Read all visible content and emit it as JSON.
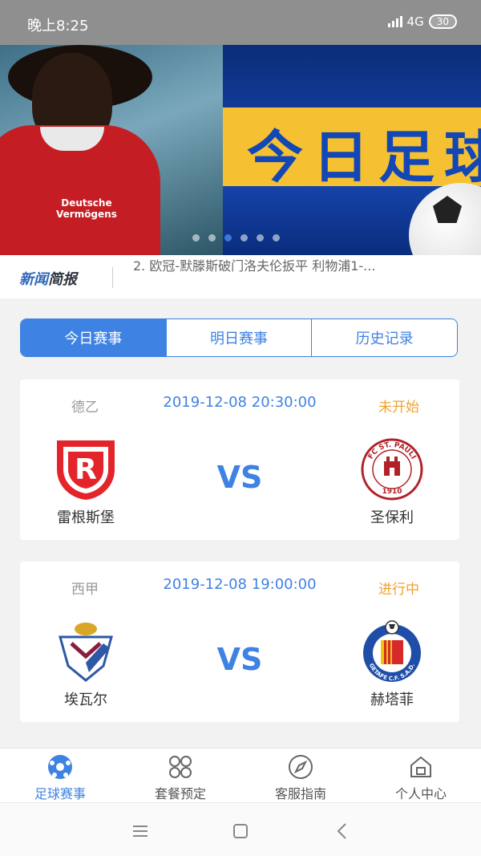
{
  "status_bar": {
    "time": "晚上8:25",
    "network": "4G",
    "battery": "30"
  },
  "banner": {
    "title": "今日足球",
    "sponsor": [
      "Deutsche",
      "Vermögens"
    ],
    "dot_count": 6,
    "active_dot": 2
  },
  "news": {
    "logo_part1": "新闻",
    "logo_part2": "简报",
    "headline": "2. 欧冠-默滕斯破门洛夫伦扳平 利物浦1-..."
  },
  "tabs": [
    {
      "label": "今日赛事",
      "active": true
    },
    {
      "label": "明日赛事",
      "active": false
    },
    {
      "label": "历史记录",
      "active": false
    }
  ],
  "matches": [
    {
      "league": "德乙",
      "time": "2019-12-08 20:30:00",
      "status": "未开始",
      "home": {
        "name": "雷根斯堡",
        "logo": "regensburg-badge"
      },
      "vs": "VS",
      "away": {
        "name": "圣保利",
        "logo": "st-pauli-badge",
        "badge_text": "FC ST. PAULI 1910"
      }
    },
    {
      "league": "西甲",
      "time": "2019-12-08 19:00:00",
      "status": "进行中",
      "home": {
        "name": "埃瓦尔",
        "logo": "eibar-badge"
      },
      "vs": "VS",
      "away": {
        "name": "赫塔菲",
        "logo": "getafe-badge",
        "badge_text": "GETAFE C.F. S.A.D."
      }
    }
  ],
  "bottom_nav": [
    {
      "label": "足球赛事",
      "icon": "soccer-ball-icon",
      "active": true
    },
    {
      "label": "套餐预定",
      "icon": "grid-icon",
      "active": false
    },
    {
      "label": "客服指南",
      "icon": "compass-icon",
      "active": false
    },
    {
      "label": "个人中心",
      "icon": "home-icon",
      "active": false
    }
  ],
  "colors": {
    "accent": "#3e82e3",
    "status_pending": "#f0a22d",
    "status_live": "#f0a22d"
  }
}
